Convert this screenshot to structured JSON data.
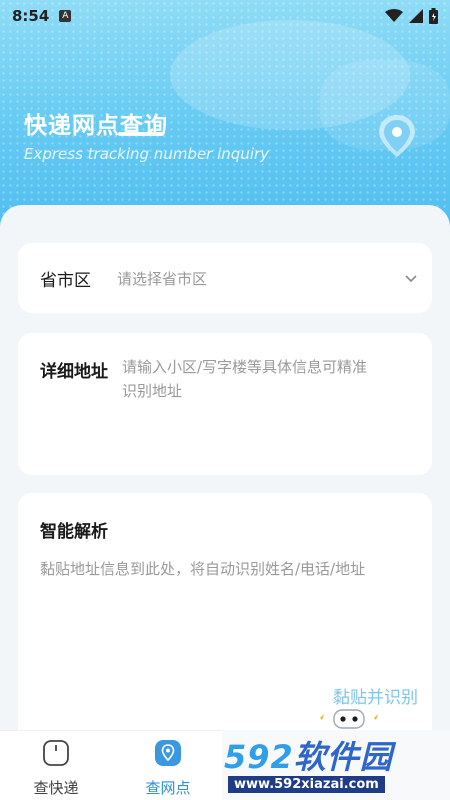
{
  "status_bar": {
    "time": "8:54",
    "indicator": "A"
  },
  "header": {
    "title": "快递网点查询",
    "subtitle": "Express tracking number inquiry",
    "pin_icon": "location-pin-icon"
  },
  "region_card": {
    "label": "省市区",
    "placeholder": "请选择省市区",
    "dropdown_icon": "chevron-down-icon"
  },
  "address_card": {
    "label": "详细地址",
    "placeholder_line1": "请输入小区/写字楼等具体信息可精准",
    "placeholder_line2": "识别地址"
  },
  "smart_card": {
    "title": "智能解析",
    "placeholder": "黏贴地址信息到此处，将自动识别姓名/电话/地址",
    "button": "黏贴并识别"
  },
  "bottom_nav": {
    "items": [
      {
        "label": "查快递",
        "icon": "package-icon",
        "active": false
      },
      {
        "label": "查网点",
        "icon": "location-pin-icon",
        "active": true
      }
    ]
  },
  "watermark": {
    "logo_number": "592",
    "logo_text": "软件园",
    "url": "www.592xiazai.com"
  },
  "colors": {
    "accent": "#2e8fd8",
    "header_gradient_top": "#8fdcf6",
    "header_gradient_bottom": "#4fbdf0",
    "button_text": "#7ec5ef"
  }
}
